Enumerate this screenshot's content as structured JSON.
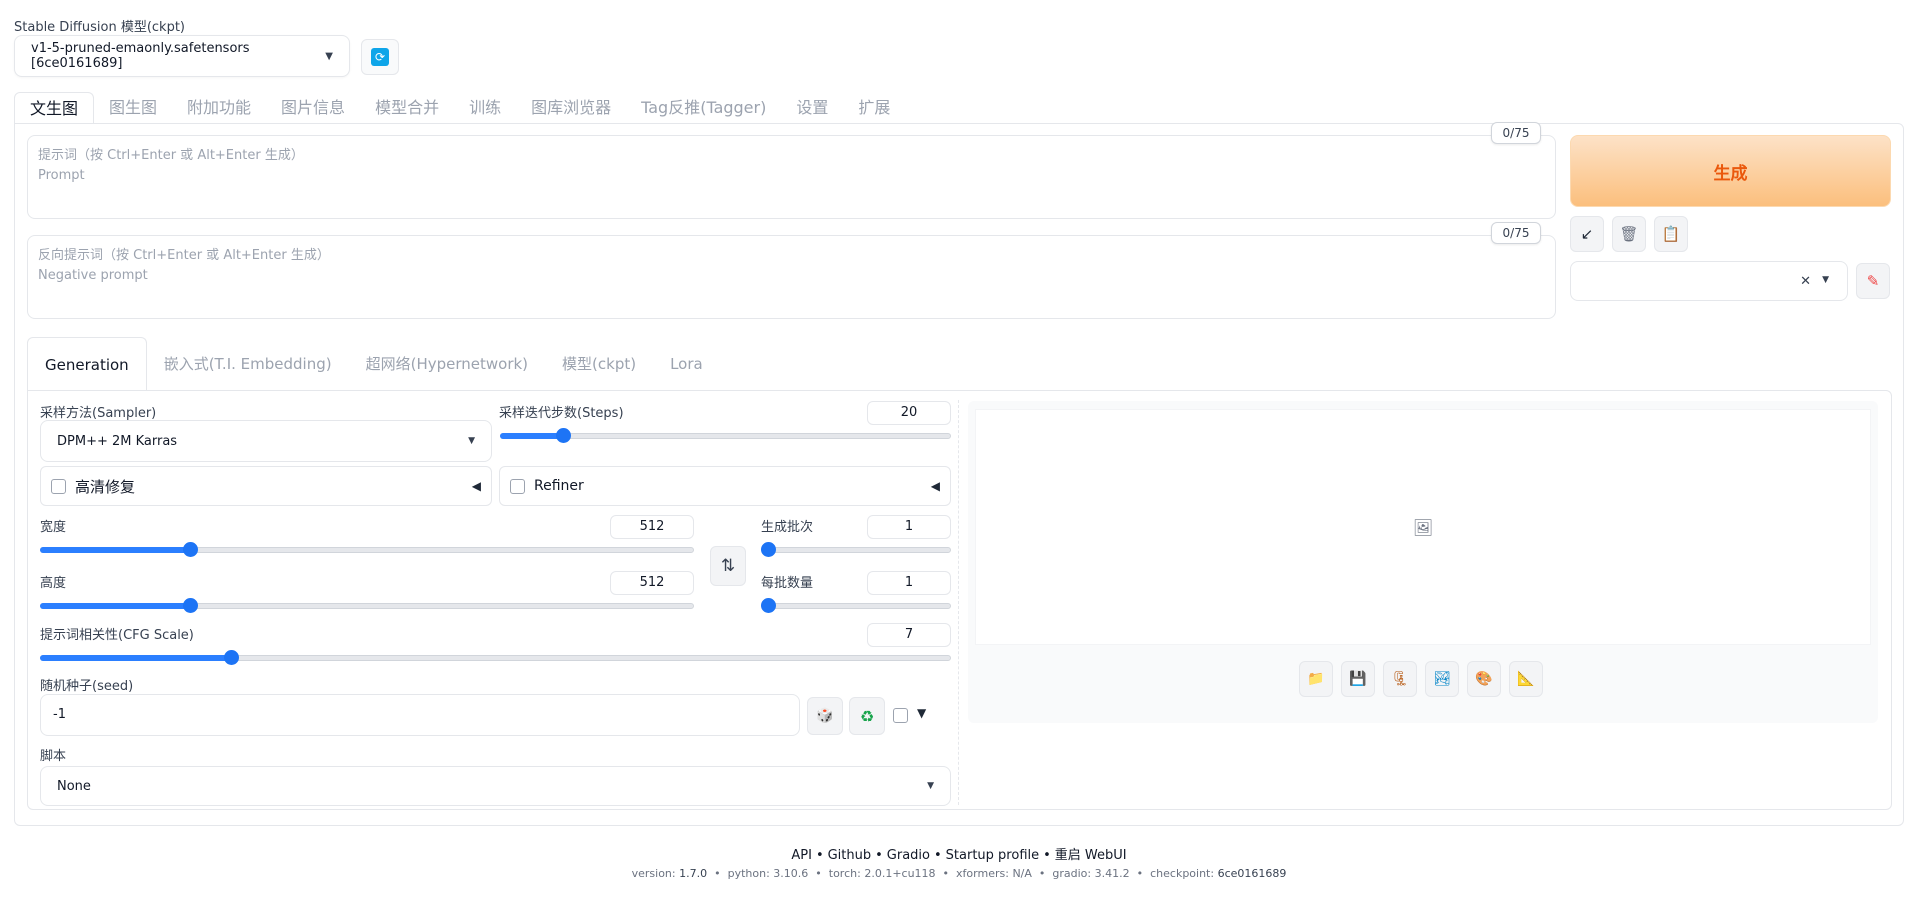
{
  "model": {
    "label": "Stable Diffusion 模型(ckpt)",
    "value": "v1-5-pruned-emaonly.safetensors [6ce0161689]"
  },
  "main_tabs": [
    "文生图",
    "图生图",
    "附加功能",
    "图片信息",
    "模型合并",
    "训练",
    "图库浏览器",
    "Tag反推(Tagger)",
    "设置",
    "扩展"
  ],
  "prompt": {
    "placeholder_line1": "提示词（按 Ctrl+Enter 或 Alt+Enter 生成）",
    "placeholder_line2": "Prompt",
    "token_count": "0/75"
  },
  "negative_prompt": {
    "placeholder_line1": "反向提示词（按 Ctrl+Enter 或 Alt+Enter 生成）",
    "placeholder_line2": "Negative prompt",
    "token_count": "0/75"
  },
  "generate_label": "生成",
  "sub_tabs": [
    "Generation",
    "嵌入式(T.I. Embedding)",
    "超网络(Hypernetwork)",
    "模型(ckpt)",
    "Lora"
  ],
  "sampler": {
    "label": "采样方法(Sampler)",
    "value": "DPM++ 2M Karras"
  },
  "steps": {
    "label": "采样迭代步数(Steps)",
    "value": "20",
    "level": 0.14
  },
  "hires_fix": {
    "label": "高清修复"
  },
  "refiner": {
    "label": "Refiner"
  },
  "width": {
    "label": "宽度",
    "value": "512",
    "level": 0.23
  },
  "height": {
    "label": "高度",
    "value": "512",
    "level": 0.23
  },
  "batch_count": {
    "label": "生成批次",
    "value": "1",
    "level": 0.0
  },
  "batch_size": {
    "label": "每批数量",
    "value": "1",
    "level": 0.0
  },
  "cfg_scale": {
    "label": "提示词相关性(CFG Scale)",
    "value": "7",
    "level": 0.21
  },
  "seed": {
    "label": "随机种子(seed)",
    "value": "-1"
  },
  "script": {
    "label": "脚本",
    "value": "None"
  },
  "footer": {
    "links": [
      "API",
      "Github",
      "Gradio",
      "Startup profile",
      "重启 WebUI"
    ],
    "separator": "•",
    "version_label": "version:",
    "version": "1.7.0",
    "python_label": "python:",
    "python": "3.10.6",
    "torch_label": "torch:",
    "torch": "2.0.1+cu118",
    "xformers_label": "xformers:",
    "xformers": "N/A",
    "gradio_label": "gradio:",
    "gradio": "3.41.2",
    "checkpoint_label": "checkpoint:",
    "checkpoint": "6ce0161689"
  },
  "icons": {
    "refresh": "refresh-icon",
    "arrow": "arrow-down-left-icon",
    "trash": "trash-icon",
    "clipboard": "clipboard-icon",
    "edit": "pencil-icon",
    "swap": "swap-icon",
    "dice": "dice-icon",
    "recycle": "recycle-icon",
    "image": "image-icon",
    "folder": "folder-icon",
    "save": "save-icon",
    "zip": "zip-icon",
    "send_img": "send-to-img2img-icon",
    "send_inpaint": "send-to-inpaint-icon",
    "send_extras": "send-to-extras-icon"
  },
  "colors": {
    "accent": "#2b7fff",
    "generate_text": "#ea580c"
  }
}
